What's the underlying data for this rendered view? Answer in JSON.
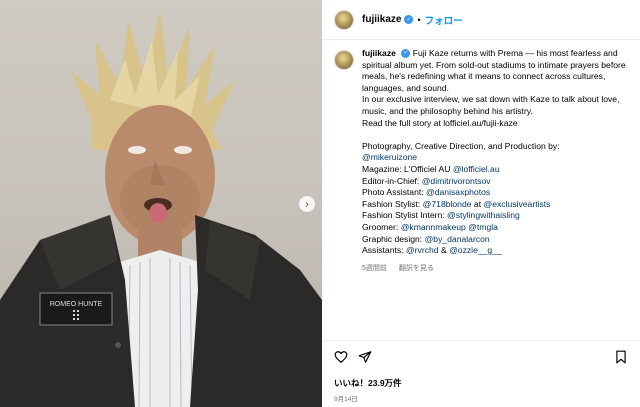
{
  "header": {
    "username": "fujiikaze",
    "separator": "•",
    "follow_label": "フォロー"
  },
  "caption": {
    "username": "fujiikaze",
    "lines": [
      "Fuji Kaze returns with Prema — his most fearless and spiritual album yet. From sold-out stadiums to intimate prayers before meals, he's redefining what it means to connect across cultures, languages, and sound.",
      "In our exclusive interview, we sat down with Kaze to talk about love, music, and the philosophy behind his artistry.",
      "Read the full story at lofficiel.au/fujii-kaze"
    ],
    "credits_heading": "Photography, Creative Direction, and Production by:",
    "credits_handle": "@mikeruizone",
    "credits": [
      {
        "label": "Magazine: L'Officiel AU ",
        "handle": "@lofficiel.au",
        "after": "",
        "handle2": ""
      },
      {
        "label": "Editor-in-Chief: ",
        "handle": "@dimitrivorontsov",
        "after": "",
        "handle2": ""
      },
      {
        "label": "Photo Assistant: ",
        "handle": "@danisaxphotos",
        "after": "",
        "handle2": ""
      },
      {
        "label": "Fashion Stylist: ",
        "handle": "@718blonde",
        "after": " at ",
        "handle2": "@exclusiveartists"
      },
      {
        "label": "Fashion Stylist Intern: ",
        "handle": "@stylingwithaisling",
        "after": "",
        "handle2": ""
      },
      {
        "label": "Groomer: ",
        "handle": "@kmannmakeup",
        "after": " @",
        "handle2": "tmgla"
      },
      {
        "label": "Graphic design: ",
        "handle": "@by_danalarcon",
        "after": "",
        "handle2": ""
      },
      {
        "label": "Assistants: ",
        "handle": "@rvrchd",
        "after": " & ",
        "handle2": "@ozzie__g__"
      }
    ],
    "time_ago": "5週間前",
    "translate_label": "翻訳を見る"
  },
  "photo": {
    "jacket_patch_text": "ROMEO HUNTE"
  },
  "footer": {
    "likes": "いいね！23.9万件",
    "date": "9月14日"
  },
  "icons": [
    "heart-icon",
    "share-icon",
    "bookmark-icon",
    "verified-icon",
    "chevron-right-icon"
  ],
  "colors": {
    "link": "#00376b",
    "follow": "#0095f6",
    "verified": "#3897f0",
    "muted": "#737373"
  }
}
